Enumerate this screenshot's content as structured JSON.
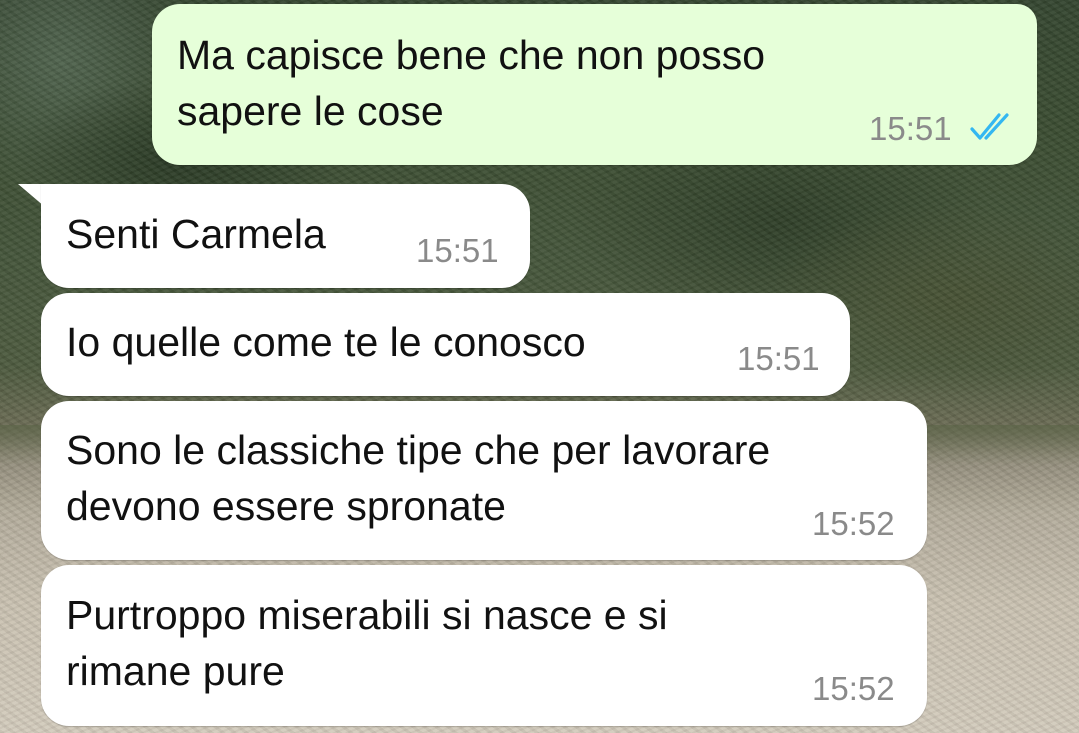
{
  "messages": [
    {
      "direction": "outgoing",
      "lines": [
        "Ma capisce bene che non posso",
        "sapere le cose"
      ],
      "time": "15:51",
      "status_icon": "double-check-read-icon",
      "status_color": "#34b7f1"
    },
    {
      "direction": "incoming",
      "lines": [
        "Senti Carmela"
      ],
      "time": "15:51"
    },
    {
      "direction": "incoming",
      "lines": [
        "Io quelle come te le conosco"
      ],
      "time": "15:51"
    },
    {
      "direction": "incoming",
      "lines": [
        "Sono le classiche tipe che per lavorare",
        "devono essere spronate"
      ],
      "time": "15:52"
    },
    {
      "direction": "incoming",
      "lines": [
        "Purtroppo miserabili si nasce e si",
        "rimane pure"
      ],
      "time": "15:52"
    }
  ],
  "colors": {
    "outgoing_bubble": "#e6ffd9",
    "incoming_bubble": "#ffffff",
    "timestamp": "#8a8a8a",
    "read_ticks": "#34b7f1"
  }
}
